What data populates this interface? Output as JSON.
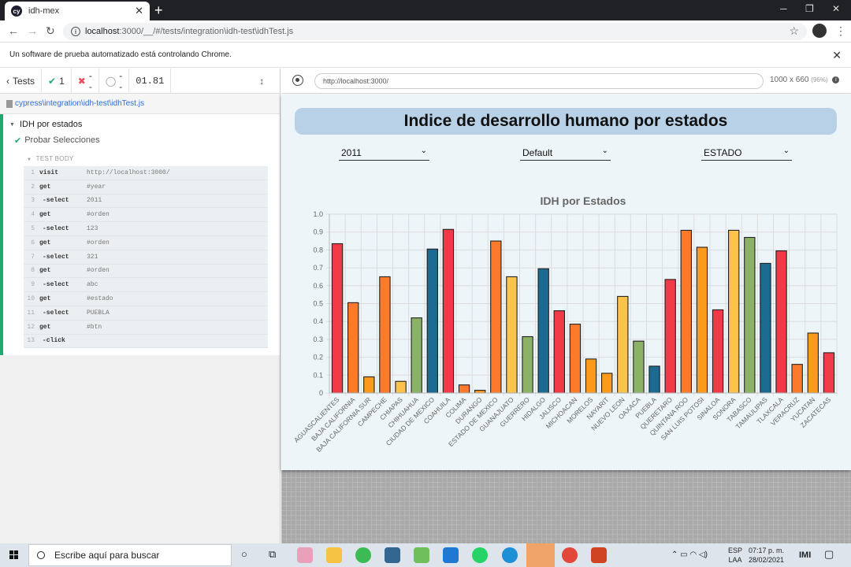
{
  "browser": {
    "tab_title": "idh-mex",
    "favicon_text": "cy",
    "url_host": "localhost",
    "url_rest": ":3000/__/#/tests/integration\\idh-test\\idhTest.js",
    "automation_banner": "Un software de prueba automatizado está controlando Chrome."
  },
  "reporter": {
    "tests_label": "Tests",
    "passed": "1",
    "failed": "--",
    "pending": "--",
    "duration": "01.81",
    "spec_path": "cypress\\integration\\idh-test\\idhTest.js",
    "suite": "IDH por estados",
    "test": "Probar Selecciones",
    "test_body_label": "TEST BODY",
    "commands": [
      {
        "n": "1",
        "name": "visit",
        "arg": "http://localhost:3000/"
      },
      {
        "n": "2",
        "name": "get",
        "arg": "#year"
      },
      {
        "n": "3",
        "name": "-select",
        "arg": "2011"
      },
      {
        "n": "4",
        "name": "get",
        "arg": "#orden"
      },
      {
        "n": "5",
        "name": "-select",
        "arg": "123"
      },
      {
        "n": "6",
        "name": "get",
        "arg": "#orden"
      },
      {
        "n": "7",
        "name": "-select",
        "arg": "321"
      },
      {
        "n": "8",
        "name": "get",
        "arg": "#orden"
      },
      {
        "n": "9",
        "name": "-select",
        "arg": "abc"
      },
      {
        "n": "10",
        "name": "get",
        "arg": "#estado"
      },
      {
        "n": "11",
        "name": "-select",
        "arg": "PUEBLA"
      },
      {
        "n": "12",
        "name": "get",
        "arg": "#btn"
      },
      {
        "n": "13",
        "name": "-click",
        "arg": ""
      }
    ]
  },
  "aut": {
    "url": "http://localhost:3000/",
    "viewport": "1000 x 660",
    "scale": "(96%)"
  },
  "app": {
    "title": "Indice de desarrollo humano por estados",
    "year_select": "2011",
    "order_select": "Default",
    "state_select": "ESTADO"
  },
  "chart_data": {
    "type": "bar",
    "title": "IDH por Estados",
    "ylim": [
      0,
      1.0
    ],
    "yticks": [
      "0",
      "0.1",
      "0.2",
      "0.3",
      "0.4",
      "0.5",
      "0.6",
      "0.7",
      "0.8",
      "0.9",
      "1.0"
    ],
    "grid": true,
    "categories": [
      "AGUASCALIENTES",
      "BAJA CALIFORNIA",
      "BAJA CALIFORNIA SUR",
      "CAMPECHE",
      "CHIAPAS",
      "CHIHUAHUA",
      "CIUDAD DE MEXICO",
      "COAHUILA",
      "COLIMA",
      "DURANGO",
      "ESTADO DE MEXICO",
      "GUANAJUATO",
      "GUERRERO",
      "HIDALGO",
      "JALISCO",
      "MICHOACAN",
      "MORELOS",
      "NAYARIT",
      "NUEVO LEON",
      "OAXACA",
      "PUEBLA",
      "QUERETARO",
      "QUINTANA ROO",
      "SAN LUIS POTOSI",
      "SINALOA",
      "SONORA",
      "TABASCO",
      "TAMAULIPAS",
      "TLAXCALA",
      "VERACRUZ",
      "YUCATAN",
      "ZACATECAS"
    ],
    "values": [
      0.835,
      0.505,
      0.09,
      0.65,
      0.065,
      0.42,
      0.805,
      0.915,
      0.045,
      0.015,
      0.85,
      0.65,
      0.315,
      0.695,
      0.46,
      0.385,
      0.19,
      0.11,
      0.54,
      0.29,
      0.15,
      0.635,
      0.91,
      0.815,
      0.465,
      0.91,
      0.87,
      0.725,
      0.795,
      0.16,
      0.335,
      0.225
    ],
    "colors": [
      "#f03a47",
      "#fb7a2b",
      "#fb9a1b",
      "#fb7a2b",
      "#fbc24c",
      "#8bb267",
      "#1c6a92",
      "#f03a47",
      "#fb7a2b",
      "#fb9a1b",
      "#fb7a2b",
      "#fbc24c",
      "#8bb267",
      "#1c6a92",
      "#f03a47",
      "#fb7a2b",
      "#fb9a1b",
      "#fb9a1b",
      "#fbc24c",
      "#8bb267",
      "#1c6a92",
      "#f03a47",
      "#fb7a2b",
      "#fb9a1b",
      "#f03a47",
      "#fbc24c",
      "#8bb267",
      "#1c6a92",
      "#f03a47",
      "#fb7a2b",
      "#fb9a1b",
      "#f03a47"
    ]
  },
  "taskbar": {
    "search_placeholder": "Escribe aquí para buscar",
    "lang_top": "ESP",
    "lang_bottom": "LAA",
    "time": "07:17 p. m.",
    "date": "28/02/2021"
  }
}
